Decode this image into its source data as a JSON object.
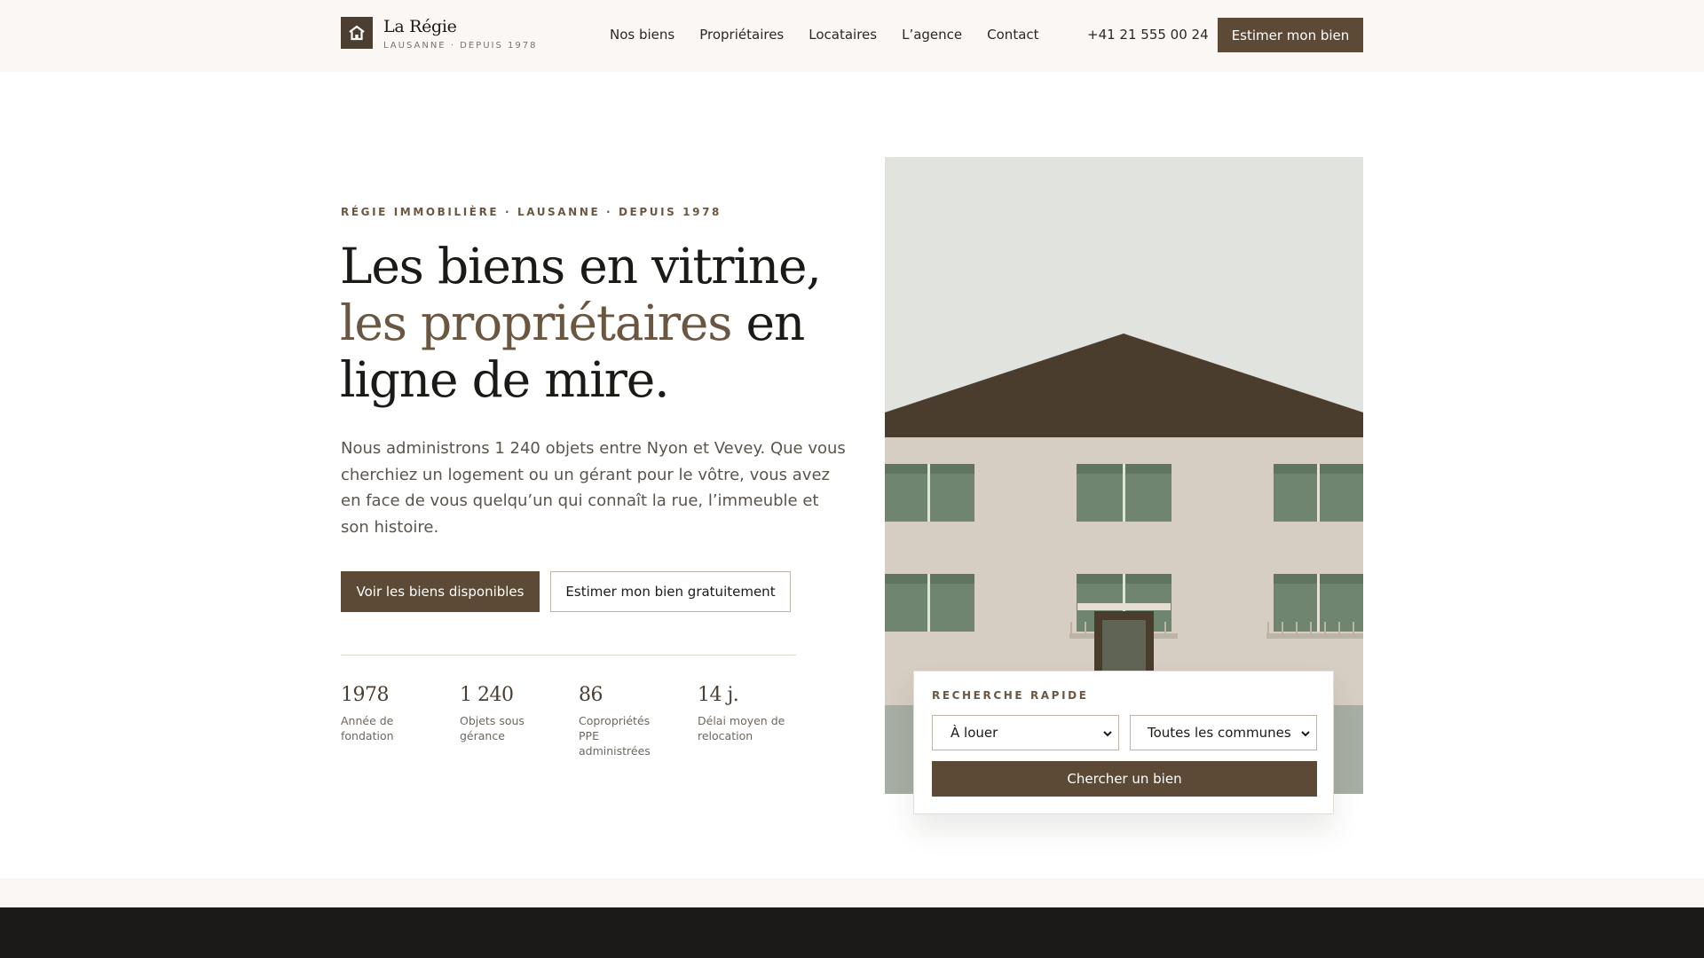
{
  "header": {
    "brand_name": "La Régie",
    "brand_sub": "LAUSANNE · DEPUIS 1978",
    "logo_icon": "house-icon",
    "nav": [
      {
        "label": "Nos biens"
      },
      {
        "label": "Propriétaires"
      },
      {
        "label": "Locataires"
      },
      {
        "label": "L’agence"
      },
      {
        "label": "Contact"
      }
    ],
    "phone": "+41 21 555 00 24",
    "cta": "Estimer mon bien"
  },
  "hero": {
    "eyebrow": "RÉGIE IMMOBILIÈRE · LAUSANNE · DEPUIS 1978",
    "headline_1": "Les biens en vitrine,",
    "headline_accent": "les propriétaires",
    "headline_2": " en",
    "headline_3": "ligne de mire.",
    "lead": "Nous administrons 1 240 objets entre Nyon et Vevey. Que vous cherchiez un logement ou un gérant pour le vôtre, vous avez en face de vous quelqu’un qui connaît la rue, l’immeuble et son histoire.",
    "primary_button": "Voir les biens disponibles",
    "secondary_button": "Estimer mon bien gratuitement",
    "stats": [
      {
        "value": "1978",
        "label": "Année de fondation"
      },
      {
        "value": "1 240",
        "label": "Objets sous gérance"
      },
      {
        "value": "86",
        "label": "Copropriétés PPE administrées"
      },
      {
        "value": "14 j.",
        "label": "Délai moyen de relocation"
      }
    ]
  },
  "search": {
    "title": "RECHERCHE RAPIDE",
    "type_value": "À louer",
    "commune_value": "Toutes les communes",
    "button": "Chercher un bien"
  },
  "colors": {
    "accent": "#5c4a37",
    "accent_text": "#6a5641",
    "header_bg": "#faf7f4",
    "footer_bg": "#1b1a18"
  }
}
